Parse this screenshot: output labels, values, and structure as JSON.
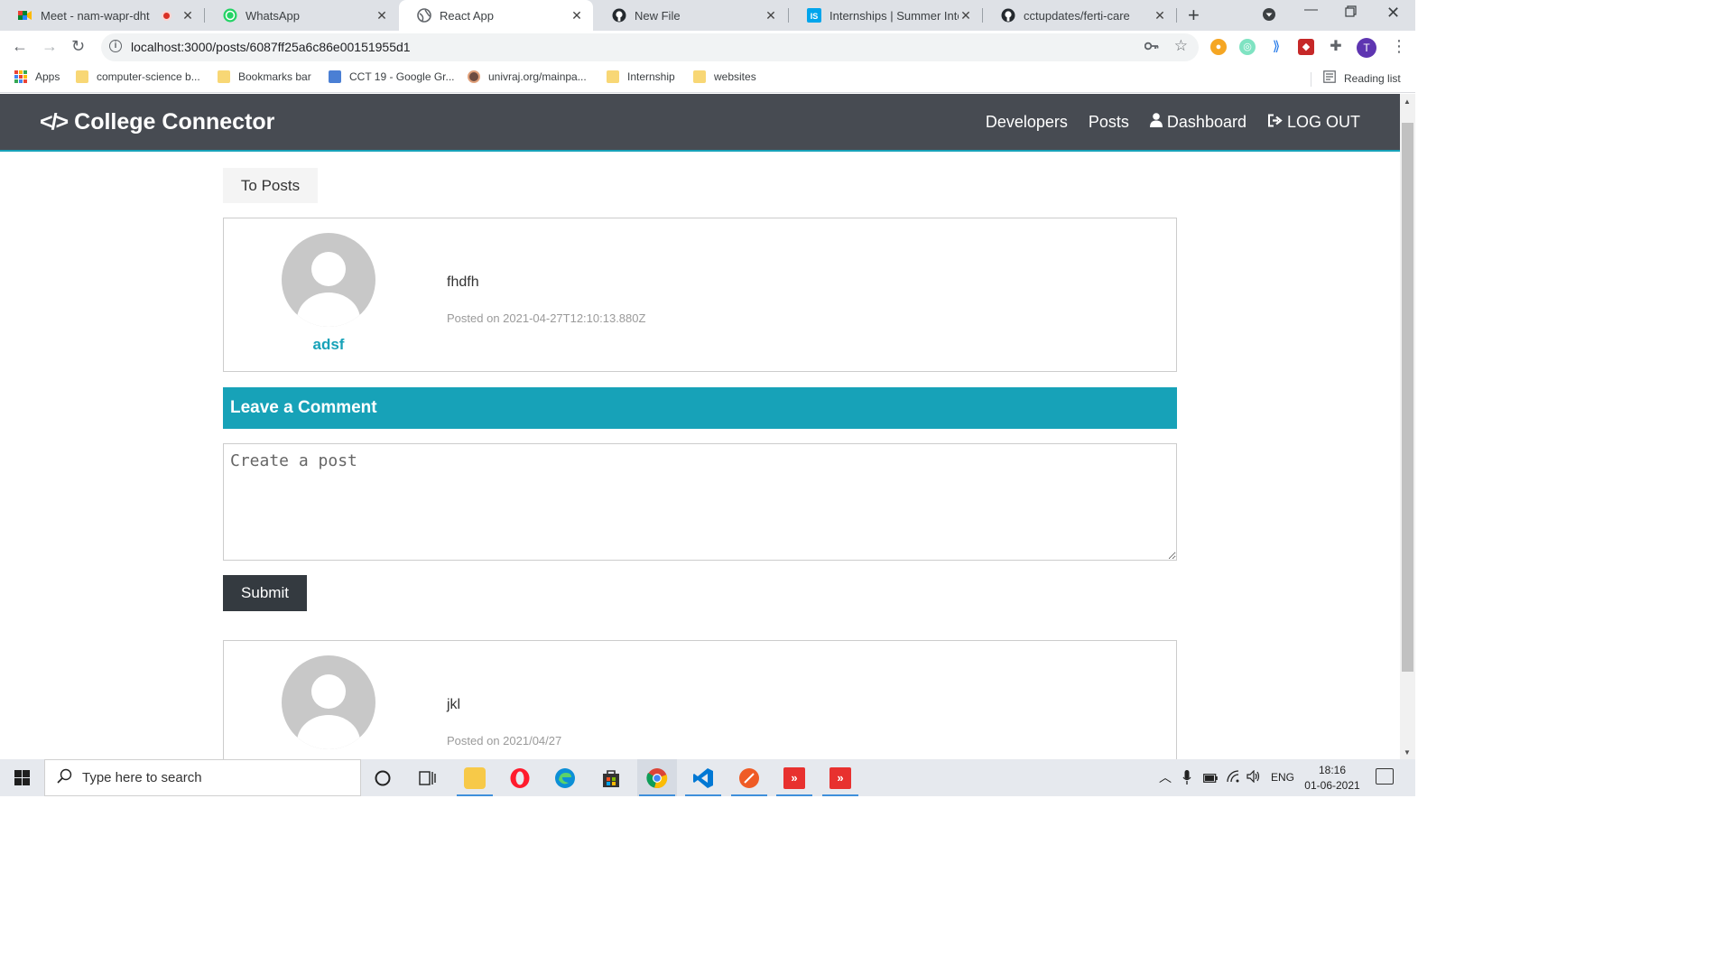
{
  "browser": {
    "tabs": [
      {
        "title": "Meet - nam-wapr-dht",
        "icon": "google-meet-icon",
        "recording": true,
        "active": false
      },
      {
        "title": "WhatsApp",
        "icon": "whatsapp-icon",
        "active": false
      },
      {
        "title": "React App",
        "icon": "globe-icon",
        "active": true
      },
      {
        "title": "New File",
        "icon": "github-icon",
        "active": false
      },
      {
        "title": "Internships | Summer Intern",
        "icon": "internshala-icon",
        "active": false
      },
      {
        "title": "cctupdates/ferti-care",
        "icon": "github-icon",
        "active": false
      }
    ],
    "url": "localhost:3000/posts/6087ff25a6c86e00151955d1",
    "profile_initial": "T",
    "bookmarks": [
      {
        "label": "Apps",
        "icon": "apps-grid-icon"
      },
      {
        "label": "computer-science b...",
        "icon": "folder-icon"
      },
      {
        "label": "Bookmarks bar",
        "icon": "folder-icon"
      },
      {
        "label": "CCT 19 - Google Gr...",
        "icon": "google-groups-icon"
      },
      {
        "label": "univraj.org/mainpa...",
        "icon": "site-icon"
      },
      {
        "label": "Internship",
        "icon": "folder-icon"
      },
      {
        "label": "websites",
        "icon": "folder-icon"
      }
    ],
    "reading_list": "Reading list"
  },
  "navbar": {
    "brand": "College Connector",
    "links": [
      {
        "label": "Developers",
        "icon": ""
      },
      {
        "label": "Posts",
        "icon": ""
      },
      {
        "label": "Dashboard",
        "icon": "user-icon"
      },
      {
        "label": "LOG OUT",
        "icon": "sign-out-icon"
      }
    ]
  },
  "page": {
    "back_button": "To Posts",
    "post": {
      "author": "adsf",
      "text": "fhdfh",
      "date": "Posted on 2021-04-27T12:10:13.880Z"
    },
    "comment_header": "Leave a Comment",
    "comment_placeholder": "Create a post",
    "submit_label": "Submit",
    "comments": [
      {
        "author": "",
        "text": "jkl",
        "date": "Posted on 2021/04/27"
      }
    ]
  },
  "taskbar": {
    "search_placeholder": "Type here to search",
    "language": "ENG",
    "time": "18:16",
    "date": "01-06-2021"
  },
  "colors": {
    "navbar_bg": "#474b52",
    "accent": "#17a2b8",
    "dark_button": "#343a40"
  }
}
